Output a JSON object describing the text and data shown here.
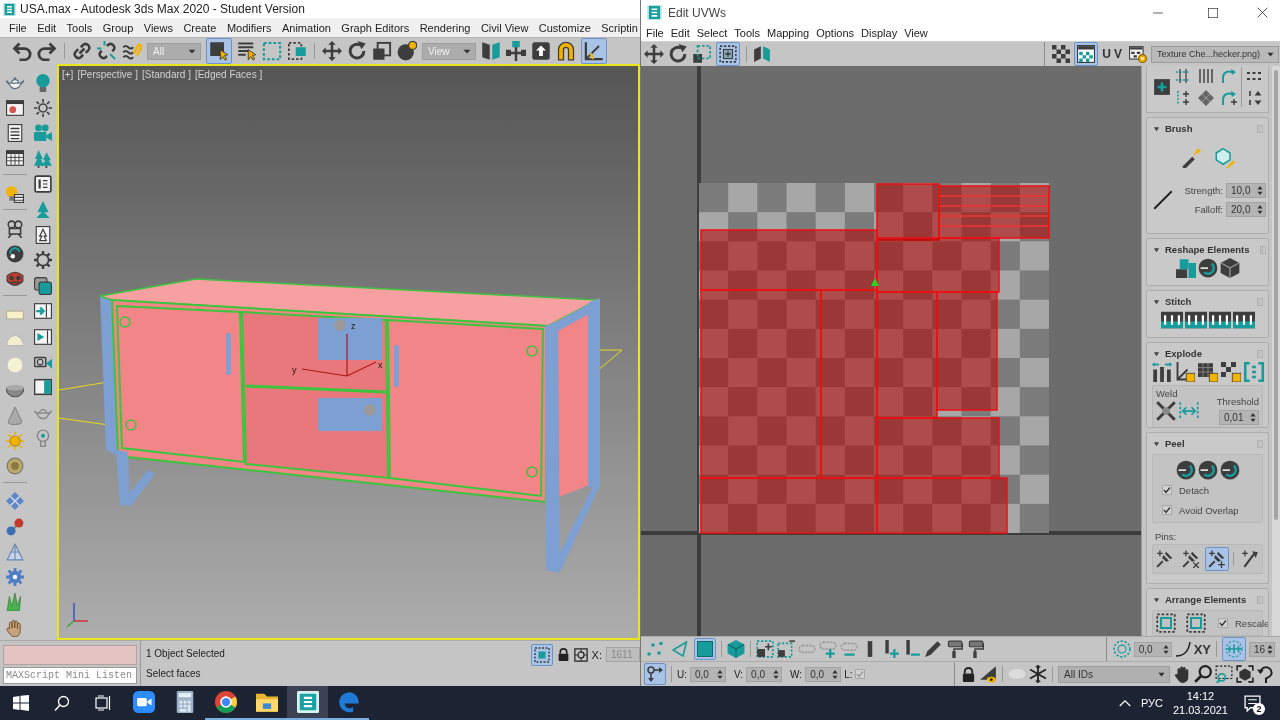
{
  "max_window": {
    "title": "USA.max - Autodesk 3ds Max 2020 - Student Version",
    "menu": [
      "File",
      "Edit",
      "Tools",
      "Group",
      "Views",
      "Create",
      "Modifiers",
      "Animation",
      "Graph Editors",
      "Rendering",
      "Civil View",
      "Customize",
      "Scriptin"
    ],
    "toolbar": {
      "selection_filter": "All",
      "select_object": {
        "on": true
      },
      "reference_coordinate_system": "View",
      "angle_snap": {
        "on": true
      }
    },
    "viewport": {
      "active": true,
      "labels": [
        "[+]",
        "[Perspective ]",
        "[Standard ]",
        "[Edged Faces ]"
      ],
      "gizmo_axes": [
        "z",
        "y",
        "x"
      ]
    },
    "listener": {
      "placeholder": "MAXScript Mini Listen"
    },
    "status": {
      "selection": "1 Object Selected",
      "prompt": "Select faces",
      "isolate": {
        "on": true
      },
      "x_label": "X:",
      "x_value": "1611"
    }
  },
  "uvw_window": {
    "title": "Edit UVWs",
    "menu": [
      "File",
      "Edit",
      "Select",
      "Tools",
      "Mapping",
      "Options",
      "Display",
      "View"
    ],
    "toolbar": {
      "freeform_mode": {
        "on": true
      },
      "show_map": {
        "on": true
      },
      "uv_label": "UV",
      "texture": "Texture Che...hecker.png)"
    },
    "panel": {
      "rollouts": [
        {
          "kind": "tools",
          "expanded": true
        },
        {
          "kind": "brush",
          "title": "Brush",
          "expanded": true,
          "fields": [
            {
              "label": "Strength:",
              "value": "10,0"
            },
            {
              "label": "Falloff:",
              "value": "20,0"
            }
          ]
        },
        {
          "kind": "reshape",
          "title": "Reshape Elements",
          "expanded": true
        },
        {
          "kind": "stitch",
          "title": "Stitch",
          "expanded": true
        },
        {
          "kind": "explode",
          "title": "Explode",
          "expanded": true,
          "weld_label": "Weld",
          "threshold_label": "Threshold",
          "threshold": "0,01"
        },
        {
          "kind": "peel",
          "title": "Peel",
          "expanded": true,
          "options": [
            {
              "label": "Detach",
              "checked": true
            },
            {
              "label": "Avoid Overlap",
              "checked": true
            }
          ],
          "pins_label": "Pins:",
          "pins": [
            {
              "selected": false
            },
            {
              "selected": false
            },
            {
              "selected": true
            },
            {
              "selected": false
            }
          ]
        },
        {
          "kind": "arrange",
          "title": "Arrange Elements",
          "expanded": true,
          "options": [
            {
              "label": "Rescale",
              "checked": true
            }
          ]
        }
      ]
    },
    "bottom_toolbar": {
      "sub_object_modes": [
        {
          "selected": false
        },
        {
          "selected": false
        },
        {
          "selected": true
        }
      ],
      "soft_selection_value": "0,0",
      "axis_label": "XY",
      "grid_toggle": {
        "on": true
      },
      "grid_value": "16",
      "transform_toggle": {
        "on": true
      },
      "coordinates": [
        {
          "label": "U:",
          "value": "0,0"
        },
        {
          "label": "V:",
          "value": "0,0"
        },
        {
          "label": "W:",
          "value": "0,0"
        }
      ],
      "lock_label": "L:",
      "lock_checked": true,
      "id_filter": "All IDs"
    }
  },
  "taskbar": {
    "apps": [
      {
        "running": false,
        "active": false
      },
      {
        "running": false,
        "active": false
      },
      {
        "running": true,
        "active": false
      },
      {
        "running": true,
        "active": false
      },
      {
        "running": true,
        "active": true
      },
      {
        "running": true,
        "active": false
      }
    ],
    "language": "РУС",
    "time": "14:12",
    "date": "21.03.2021",
    "notifications": "2"
  }
}
